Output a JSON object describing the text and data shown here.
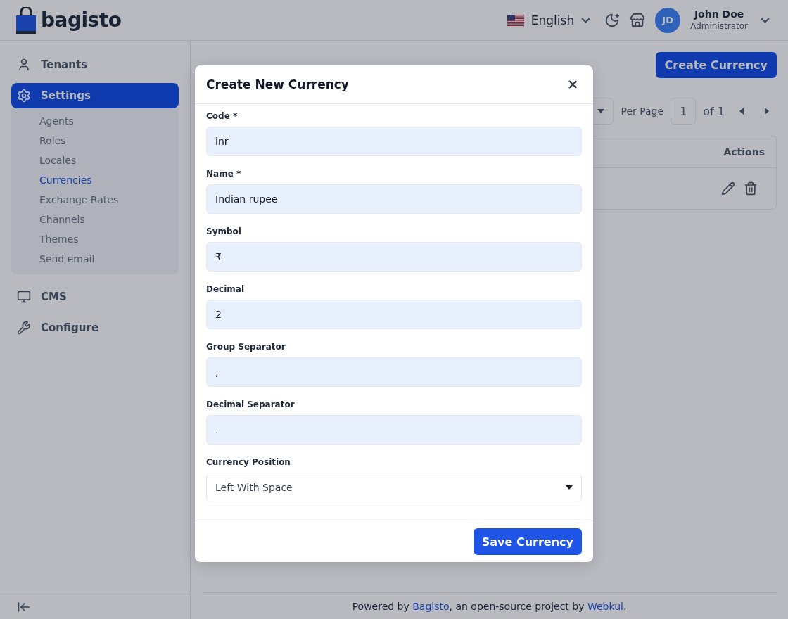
{
  "header": {
    "logo_text": "bagisto",
    "language": "English",
    "user": {
      "initials": "JD",
      "name": "John Doe",
      "role": "Administrator"
    }
  },
  "sidebar": {
    "items": [
      {
        "label": "Tenants",
        "selected": false
      },
      {
        "label": "Settings",
        "selected": true,
        "children": [
          {
            "label": "Agents",
            "selected": false
          },
          {
            "label": "Roles",
            "selected": false
          },
          {
            "label": "Locales",
            "selected": false
          },
          {
            "label": "Currencies",
            "selected": true
          },
          {
            "label": "Exchange Rates",
            "selected": false
          },
          {
            "label": "Channels",
            "selected": false
          },
          {
            "label": "Themes",
            "selected": false
          },
          {
            "label": "Send email",
            "selected": false
          }
        ]
      },
      {
        "label": "CMS",
        "selected": false
      },
      {
        "label": "Configure",
        "selected": false
      }
    ]
  },
  "page": {
    "create_button": "Create Currency",
    "per_page_label": "Per Page",
    "page_input": "1",
    "page_total": "of 1",
    "table": {
      "columns": [
        "Actions"
      ]
    }
  },
  "modal": {
    "title": "Create New Currency",
    "fields": [
      {
        "kind": "text",
        "label": "Code *",
        "value": "inr"
      },
      {
        "kind": "text",
        "label": "Name *",
        "value": "Indian rupee"
      },
      {
        "kind": "text",
        "label": "Symbol",
        "value": "₹"
      },
      {
        "kind": "text",
        "label": "Decimal",
        "value": "2"
      },
      {
        "kind": "text",
        "label": "Group Separator",
        "value": ","
      },
      {
        "kind": "text",
        "label": "Decimal Separator",
        "value": "."
      },
      {
        "kind": "select",
        "label": "Currency Position",
        "value": "Left With Space"
      }
    ],
    "save_button": "Save Currency"
  },
  "footer": {
    "parts": [
      {
        "kind": "text",
        "text": "Powered by "
      },
      {
        "kind": "link",
        "text": "Bagisto"
      },
      {
        "kind": "text",
        "text": ", an open-source project by "
      },
      {
        "kind": "link",
        "text": "Webkul"
      },
      {
        "kind": "text",
        "text": "."
      }
    ]
  }
}
